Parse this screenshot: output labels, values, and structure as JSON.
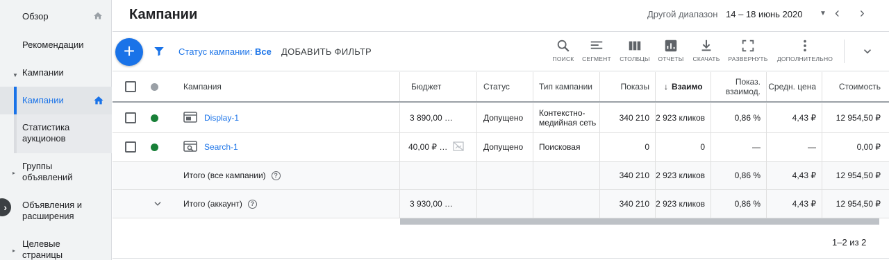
{
  "sidebar": {
    "overview": "Обзор",
    "recommendations": "Рекомендации",
    "campaigns_group": "Кампании",
    "campaigns": "Кампании",
    "auction_stats": "Статистика аукционов",
    "ad_groups": "Группы объявлений",
    "ads_ext": "Объявления и расширения",
    "landing": "Целевые страницы"
  },
  "header": {
    "title": "Кампании",
    "range_label": "Другой диапазон",
    "range_value": "14 – 18 июнь 2020"
  },
  "toolbar": {
    "status_label": "Статус кампании: ",
    "status_value": "Все",
    "add_filter": "ДОБАВИТЬ ФИЛЬТР",
    "tools": [
      {
        "label": "ПОИСК",
        "icon": "search-icon"
      },
      {
        "label": "СЕГМЕНТ",
        "icon": "segment-icon"
      },
      {
        "label": "СТОЛБЦЫ",
        "icon": "columns-icon"
      },
      {
        "label": "ОТЧЕТЫ",
        "icon": "reports-icon"
      },
      {
        "label": "СКАЧАТЬ",
        "icon": "download-icon"
      },
      {
        "label": "РАЗВЕРНУТЬ",
        "icon": "expand-icon"
      },
      {
        "label": "ДОПОЛНИТЕЛЬНО",
        "icon": "more-icon"
      }
    ]
  },
  "table": {
    "headers": {
      "campaign": "Кампания",
      "budget": "Бюджет",
      "status": "Статус",
      "type": "Тип кампании",
      "impressions": "Показы",
      "interactions": "Взаимо",
      "interaction_rate": "Показ. взаимод.",
      "avg_cost": "Средн. цена",
      "cost": "Стоимость"
    },
    "rows": [
      {
        "name": "Display-1",
        "budget": "3 890,00 …",
        "status": "Допущено",
        "type": "Контекстно-медийная сеть",
        "impressions": "340 210",
        "interactions": "2 923 кликов",
        "rate": "0,86 %",
        "avg": "4,43 ₽",
        "cost": "12 954,50 ₽",
        "status_color": "#188038"
      },
      {
        "name": "Search-1",
        "budget": "40,00 ₽ …",
        "status": "Допущено",
        "type": "Поисковая",
        "impressions": "0",
        "interactions": "0",
        "rate": "—",
        "avg": "—",
        "cost": "0,00 ₽",
        "status_color": "#188038"
      }
    ],
    "totals": [
      {
        "label": "Итого (все кампании)",
        "budget": "",
        "impressions": "340 210",
        "interactions": "2 923 кликов",
        "rate": "0,86 %",
        "avg": "4,43 ₽",
        "cost": "12 954,50 ₽"
      },
      {
        "label": "Итого (аккаунт)",
        "budget": "3 930,00 …",
        "impressions": "340 210",
        "interactions": "2 923 кликов",
        "rate": "0,86 %",
        "avg": "4,43 ₽",
        "cost": "12 954,50 ₽"
      }
    ],
    "pagination": "1–2 из 2"
  },
  "colors": {
    "accent": "#1a73e8",
    "enabled": "#188038"
  }
}
